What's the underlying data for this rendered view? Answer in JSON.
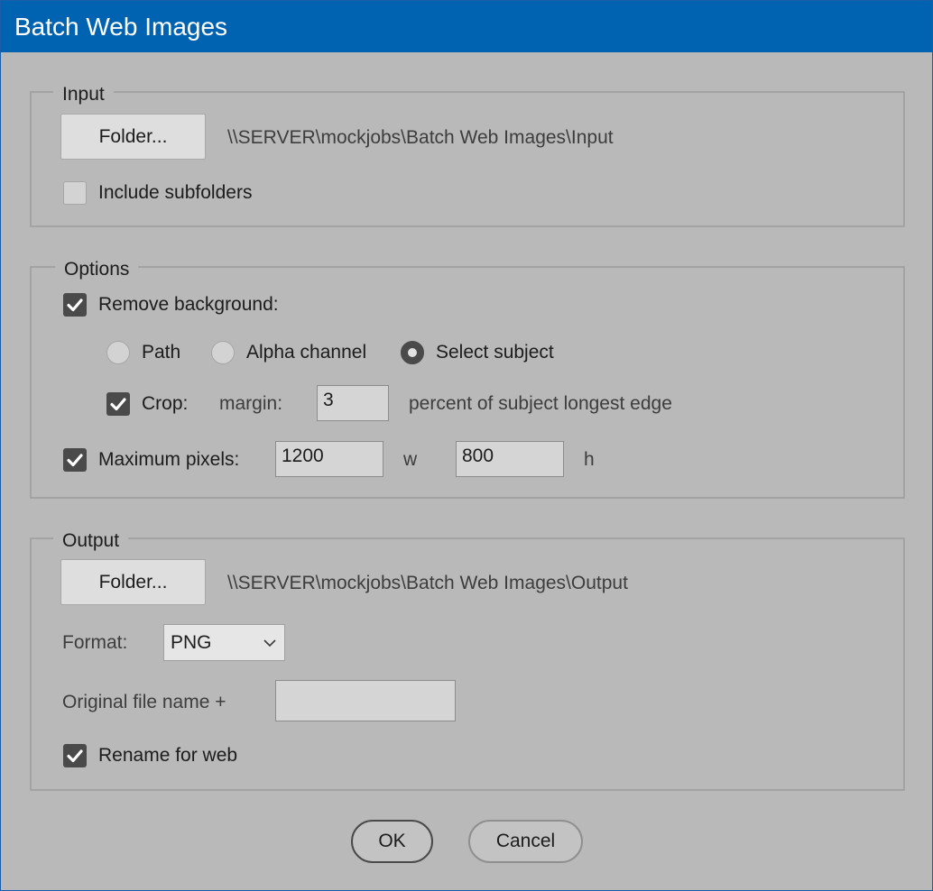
{
  "window": {
    "title": "Batch Web Images"
  },
  "input": {
    "legend": "Input",
    "folder_button": "Folder...",
    "folder_path": "\\\\SERVER\\mockjobs\\Batch Web Images\\Input",
    "include_subfolders": {
      "label": "Include subfolders",
      "checked": false
    }
  },
  "options": {
    "legend": "Options",
    "remove_background": {
      "label": "Remove background:",
      "checked": true
    },
    "method": {
      "path": "Path",
      "alpha_channel": "Alpha channel",
      "select_subject": "Select subject",
      "selected": "Select subject"
    },
    "crop": {
      "label": "Crop:",
      "checked": true,
      "margin_label": "margin:",
      "margin_value": "3",
      "suffix": "percent of subject longest edge"
    },
    "max_pixels": {
      "label": "Maximum pixels:",
      "checked": true,
      "width": "1200",
      "width_unit": "w",
      "height": "800",
      "height_unit": "h"
    }
  },
  "output": {
    "legend": "Output",
    "folder_button": "Folder...",
    "folder_path": "\\\\SERVER\\mockjobs\\Batch Web Images\\Output",
    "format_label": "Format:",
    "format_value": "PNG",
    "filename_label": "Original file name +",
    "filename_suffix": "",
    "rename_for_web": {
      "label": "Rename for web",
      "checked": true
    }
  },
  "buttons": {
    "ok": "OK",
    "cancel": "Cancel"
  },
  "colors": {
    "titlebar": "#0063b1",
    "dialog_bg": "#b9b9b9",
    "check_fill": "#4a4a4a"
  }
}
